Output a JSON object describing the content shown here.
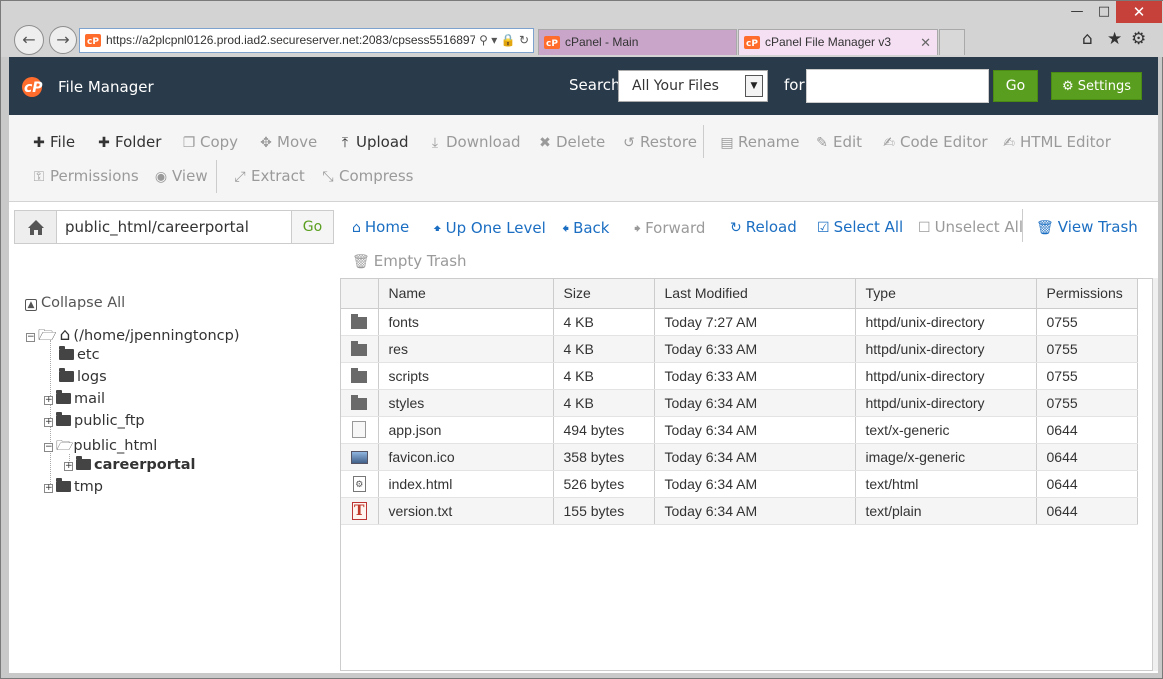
{
  "browser": {
    "url": "https://a2plcpnl0126.prod.iad2.secureserver.net:2083/cpsess5516897",
    "tabs": [
      {
        "label": "cPanel - Main"
      },
      {
        "label": "cPanel File Manager v3"
      }
    ],
    "icons": [
      "back-arrow-icon",
      "forward-arrow-icon",
      "search-icon",
      "lock-icon",
      "refresh-icon",
      "home-icon",
      "star-icon",
      "gear-icon"
    ]
  },
  "header": {
    "app_title": "File Manager",
    "search_label": "Search",
    "search_scope": "All Your Files",
    "for_label": "for",
    "search_value": "",
    "go_label": "Go",
    "settings_label": "Settings"
  },
  "toolbar": {
    "row1": [
      {
        "label": "File",
        "icon": "plus-icon",
        "enabled": true
      },
      {
        "label": "Folder",
        "icon": "plus-icon",
        "enabled": true
      },
      {
        "label": "Copy",
        "icon": "copy-icon",
        "enabled": false
      },
      {
        "label": "Move",
        "icon": "move-icon",
        "enabled": false
      },
      {
        "label": "Upload",
        "icon": "upload-icon",
        "enabled": true
      },
      {
        "label": "Download",
        "icon": "download-icon",
        "enabled": false
      },
      {
        "label": "Delete",
        "icon": "delete-icon",
        "enabled": false
      },
      {
        "label": "Restore",
        "icon": "restore-icon",
        "enabled": false
      },
      {
        "label": "Rename",
        "icon": "file-icon",
        "enabled": false
      },
      {
        "label": "Edit",
        "icon": "pencil-icon",
        "enabled": false
      },
      {
        "label": "Code Editor",
        "icon": "code-editor-icon",
        "enabled": false
      },
      {
        "label": "HTML Editor",
        "icon": "html-editor-icon",
        "enabled": false
      }
    ],
    "row2": [
      {
        "label": "Permissions",
        "icon": "key-icon",
        "enabled": false
      },
      {
        "label": "View",
        "icon": "eye-icon",
        "enabled": false
      },
      {
        "label": "Extract",
        "icon": "expand-icon",
        "enabled": false
      },
      {
        "label": "Compress",
        "icon": "compress-icon",
        "enabled": false
      }
    ]
  },
  "pathbar": {
    "path": "public_html/careerportal",
    "go_label": "Go"
  },
  "nav": {
    "home": "Home",
    "up_one_level": "Up One Level",
    "back": "Back",
    "forward": "Forward",
    "reload": "Reload",
    "select_all": "Select All",
    "unselect_all": "Unselect All",
    "view_trash": "View Trash",
    "empty_trash": "Empty Trash"
  },
  "tree": {
    "collapse_all": "Collapse All",
    "root": "(/home/jpenningtoncp)",
    "items": [
      {
        "label": "etc",
        "expandable": false
      },
      {
        "label": "logs",
        "expandable": false
      },
      {
        "label": "mail",
        "expandable": true
      },
      {
        "label": "public_ftp",
        "expandable": true
      },
      {
        "label": "public_html",
        "expandable": true,
        "expanded": true
      },
      {
        "label": "careerportal",
        "expandable": true,
        "selected": true
      },
      {
        "label": "tmp",
        "expandable": true
      }
    ]
  },
  "table": {
    "columns": [
      "Name",
      "Size",
      "Last Modified",
      "Type",
      "Permissions"
    ],
    "rows": [
      {
        "icon": "folder-icon",
        "name": "fonts",
        "size": "4 KB",
        "modified": "Today 7:27 AM",
        "type": "httpd/unix-directory",
        "perms": "0755"
      },
      {
        "icon": "folder-icon",
        "name": "res",
        "size": "4 KB",
        "modified": "Today 6:33 AM",
        "type": "httpd/unix-directory",
        "perms": "0755"
      },
      {
        "icon": "folder-icon",
        "name": "scripts",
        "size": "4 KB",
        "modified": "Today 6:33 AM",
        "type": "httpd/unix-directory",
        "perms": "0755"
      },
      {
        "icon": "folder-icon",
        "name": "styles",
        "size": "4 KB",
        "modified": "Today 6:34 AM",
        "type": "httpd/unix-directory",
        "perms": "0755"
      },
      {
        "icon": "document-icon",
        "name": "app.json",
        "size": "494 bytes",
        "modified": "Today 6:34 AM",
        "type": "text/x-generic",
        "perms": "0644"
      },
      {
        "icon": "image-icon",
        "name": "favicon.ico",
        "size": "358 bytes",
        "modified": "Today 6:34 AM",
        "type": "image/x-generic",
        "perms": "0644"
      },
      {
        "icon": "html-file-icon",
        "name": "index.html",
        "size": "526 bytes",
        "modified": "Today 6:34 AM",
        "type": "text/html",
        "perms": "0644"
      },
      {
        "icon": "text-file-icon",
        "name": "version.txt",
        "size": "155 bytes",
        "modified": "Today 6:34 AM",
        "type": "text/plain",
        "perms": "0644"
      }
    ]
  },
  "colors": {
    "header_bg": "#293a4a",
    "accent_green": "#5a9e1f",
    "link_blue": "#1b6ec2",
    "cpanel_orange": "#ff6c2c"
  }
}
